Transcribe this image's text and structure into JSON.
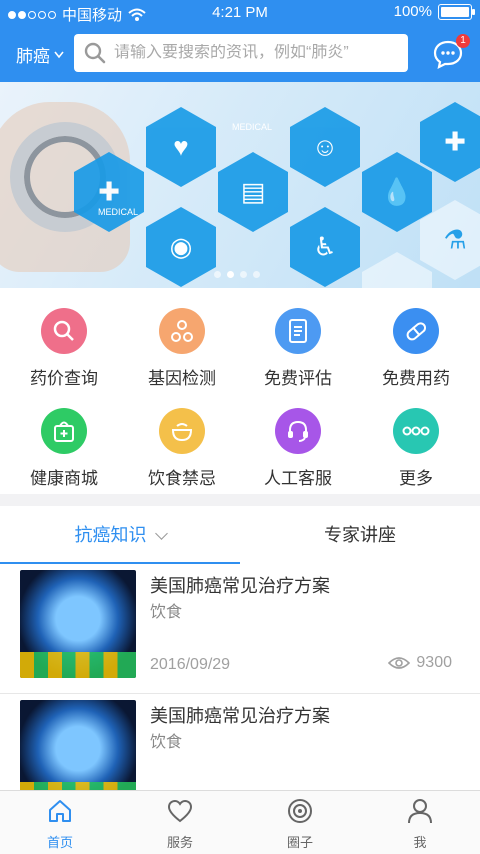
{
  "status_bar": {
    "carrier": "中国移动",
    "time": "4:21 PM",
    "battery": "100%"
  },
  "header": {
    "city": "肺癌",
    "search_placeholder": "请输入要搜索的资讯，例如“肺炎”",
    "message_badge": "1"
  },
  "banner": {
    "active_index": 1,
    "dot_count": 4,
    "labels": {
      "medical_1": "MEDICAL",
      "medical_2": "MEDICAL"
    }
  },
  "quick_items": [
    {
      "label": "药价查询",
      "color": "#ef6f8a",
      "icon": "search-icon"
    },
    {
      "label": "基因检测",
      "color": "#f6a66f",
      "icon": "gene-icon"
    },
    {
      "label": "免费评估",
      "color": "#4d9af2",
      "icon": "document-icon"
    },
    {
      "label": "免费用药",
      "color": "#3b8ff1",
      "icon": "pill-icon"
    },
    {
      "label": "健康商城",
      "color": "#2ecb65",
      "icon": "shop-bag-icon"
    },
    {
      "label": "饮食禁忌",
      "color": "#f4c04a",
      "icon": "bowl-icon"
    },
    {
      "label": "人工客服",
      "color": "#a756e8",
      "icon": "headset-icon"
    },
    {
      "label": "更多",
      "color": "#28c7b2",
      "icon": "more-icon"
    }
  ],
  "tabs": [
    {
      "label": "抗癌知识"
    },
    {
      "label": "专家讲座"
    }
  ],
  "articles": [
    {
      "title": "美国肺癌常见治疗方案",
      "category": "饮食",
      "date": "2016/09/29",
      "views": "9300"
    },
    {
      "title": "美国肺癌常见治疗方案",
      "category": "饮食"
    }
  ],
  "bottom_nav": [
    {
      "label": "首页",
      "icon": "home-icon",
      "active": true
    },
    {
      "label": "服务",
      "icon": "heart-icon",
      "active": false
    },
    {
      "label": "圈子",
      "icon": "circle-icon",
      "active": false
    },
    {
      "label": "我",
      "icon": "user-icon",
      "active": false
    }
  ],
  "colors": {
    "primary": "#2f8ff0",
    "badge": "#ef3b3b"
  }
}
